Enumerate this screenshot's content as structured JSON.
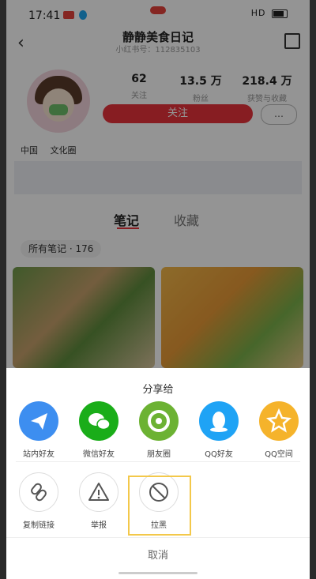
{
  "status": {
    "time": "17:41",
    "right": "HD"
  },
  "nav": {
    "title": "静静美食日记",
    "subtitle": "小红书号：112835103"
  },
  "stats": [
    {
      "num": "62",
      "label": "关注"
    },
    {
      "num": "13.5 万",
      "label": "粉丝"
    },
    {
      "num": "218.4 万",
      "label": "获赞与收藏"
    }
  ],
  "profile": {
    "follow": "关注",
    "tags": [
      "中国",
      "文化圈"
    ]
  },
  "tabs": {
    "active": "笔记",
    "inactive": "收藏"
  },
  "notes_pill": "所有笔记 · 176",
  "share": {
    "title": "分享给",
    "targets": [
      {
        "label": "站内好友",
        "icon": "send-icon",
        "color": "#3d8ef0"
      },
      {
        "label": "微信好友",
        "icon": "wechat-icon",
        "color": "#1aad19"
      },
      {
        "label": "朋友圈",
        "icon": "moments-icon",
        "color": "#6cb233"
      },
      {
        "label": "QQ好友",
        "icon": "qq-icon",
        "color": "#1fa3f5"
      },
      {
        "label": "QQ空间",
        "icon": "qzone-icon",
        "color": "#f5b32b"
      }
    ],
    "actions": [
      {
        "label": "复制链接",
        "icon": "link-icon"
      },
      {
        "label": "举报",
        "icon": "warning-icon"
      },
      {
        "label": "拉黑",
        "icon": "block-icon"
      }
    ],
    "cancel": "取消"
  }
}
